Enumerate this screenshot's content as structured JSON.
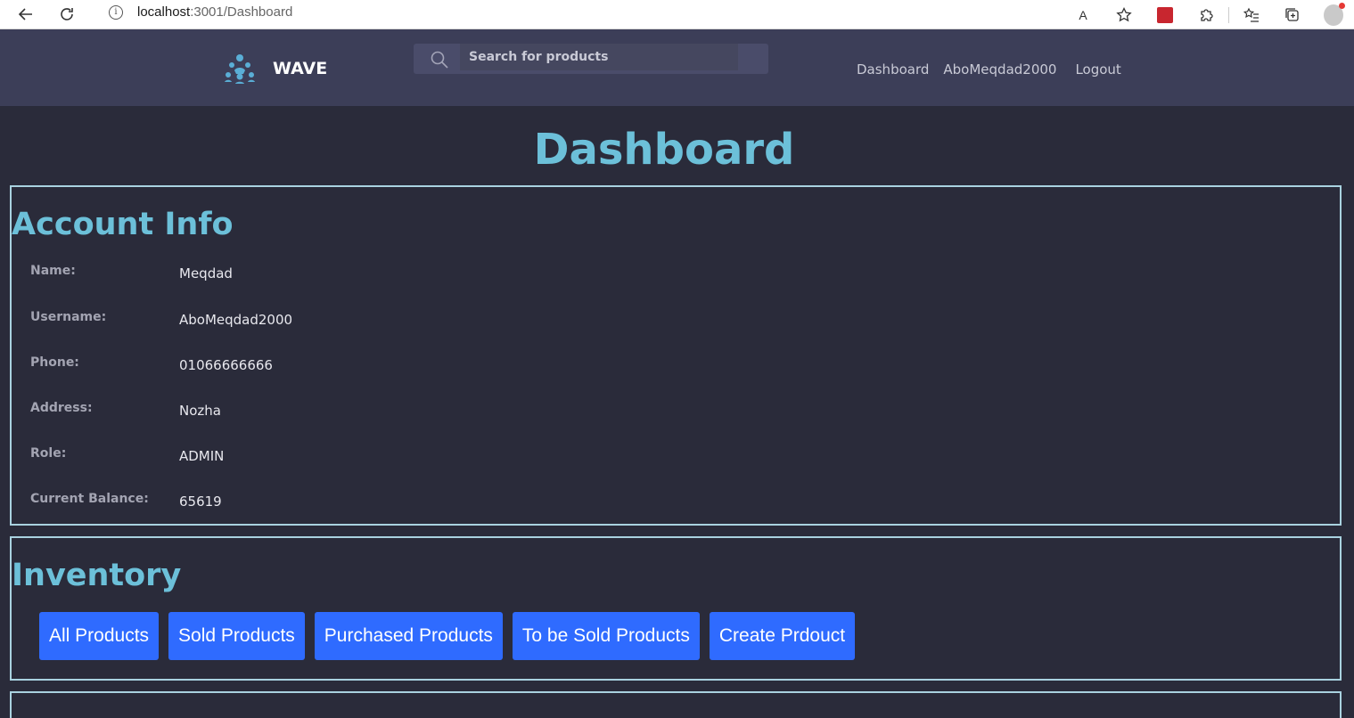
{
  "browser": {
    "url_host": "localhost",
    "url_rest": ":3001/Dashboard",
    "read_aloud_label": "A",
    "info_glyph": "i"
  },
  "navbar": {
    "brand": "WAVE",
    "search_placeholder": "Search for products",
    "links": [
      "Dashboard",
      "AboMeqdad2000",
      "Logout"
    ]
  },
  "page": {
    "title": "Dashboard"
  },
  "account": {
    "title": "Account Info",
    "rows": [
      {
        "label": "Name:",
        "value": "Meqdad"
      },
      {
        "label": "Username:",
        "value": "AboMeqdad2000"
      },
      {
        "label": "Phone:",
        "value": "01066666666"
      },
      {
        "label": "Address:",
        "value": "Nozha"
      },
      {
        "label": "Role:",
        "value": "ADMIN"
      },
      {
        "label": "Current Balance:",
        "value": "65619"
      }
    ]
  },
  "inventory": {
    "title": "Inventory",
    "buttons": [
      "All Products",
      "Sold Products",
      "Purchased Products",
      "To be Sold Products",
      "Create Prdouct"
    ]
  },
  "colors": {
    "page_bg": "#2a2b3a",
    "navbar_bg": "#3c3e58",
    "accent_heading": "#6cc0d9",
    "section_border": "#a9d2e0",
    "button_bg": "#2f6bff"
  },
  "icons": {
    "back": "back-arrow-icon",
    "reload": "reload-icon",
    "info": "info-icon",
    "search": "search-icon",
    "logo": "wave-logo-icon"
  }
}
